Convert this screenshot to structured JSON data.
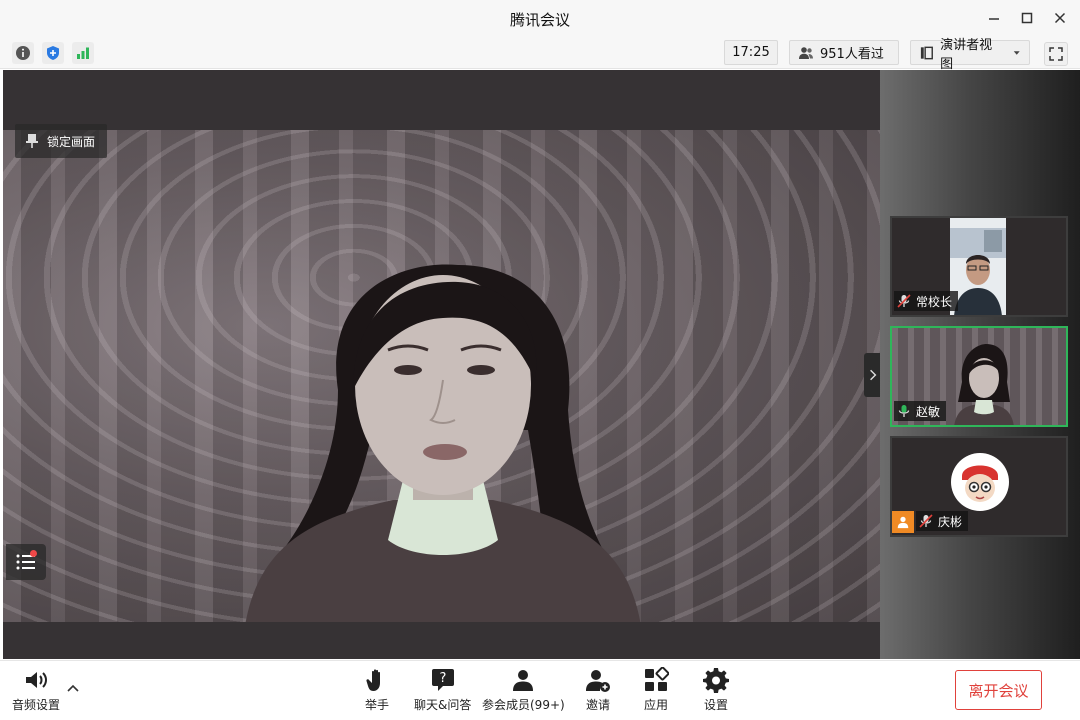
{
  "window": {
    "title": "腾讯会议"
  },
  "infobar": {
    "time": "17:25",
    "viewers": "951人看过",
    "view_mode": "演讲者视图"
  },
  "main": {
    "lock_label": "锁定画面"
  },
  "participants": [
    {
      "name": "常校长",
      "mic": "muted"
    },
    {
      "name": "赵敏",
      "mic": "active"
    },
    {
      "name": "庆彬",
      "mic": "muted"
    }
  ],
  "toolbar": {
    "audio_settings": "音频设置",
    "raise_hand": "举手",
    "chat_qa": "聊天&问答",
    "members": "参会成员(99+)",
    "invite": "邀请",
    "apps": "应用",
    "settings": "设置",
    "leave": "离开会议"
  },
  "colors": {
    "accent": "#2fb65a",
    "danger": "#e0413b",
    "blue": "#2a7ae2"
  }
}
